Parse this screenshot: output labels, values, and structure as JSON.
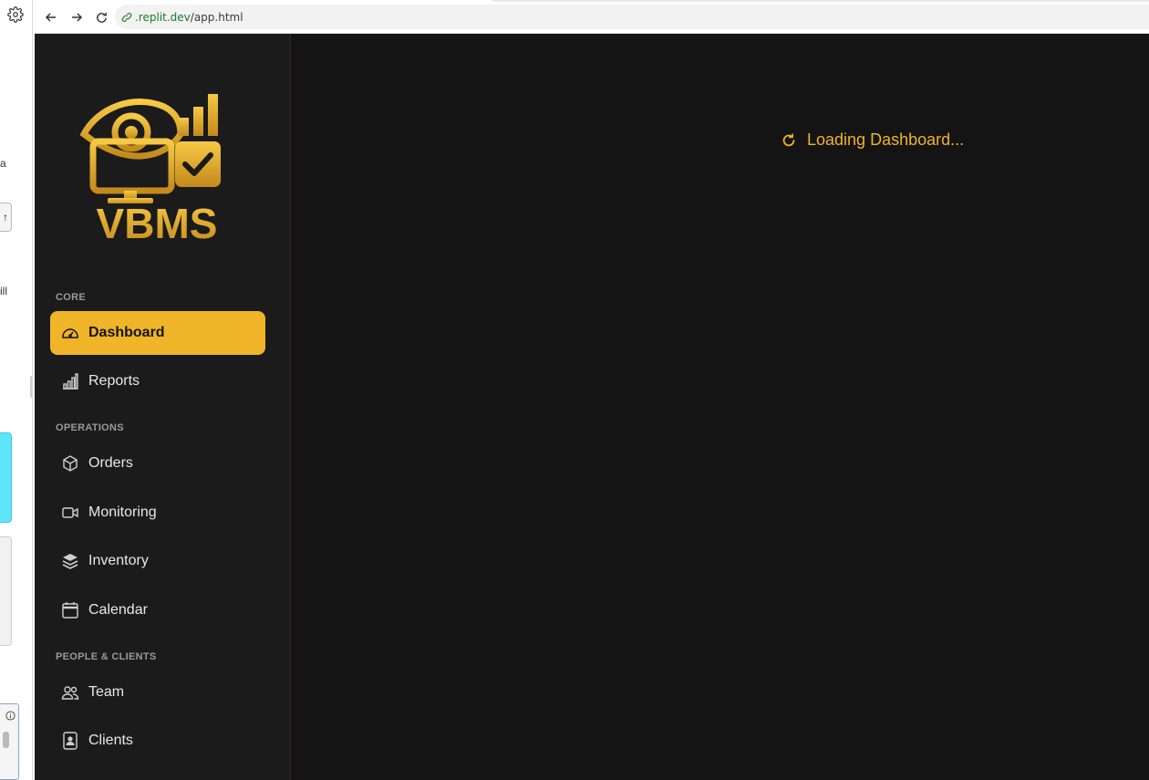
{
  "browser": {
    "url_host": ".replit.dev",
    "url_path": "/app.html"
  },
  "outer_fragments": {
    "frag1": "a",
    "frag2": "ill",
    "frag3": "↑"
  },
  "app": {
    "logo_text": "VBMS",
    "sections": [
      {
        "label": "CORE",
        "items": [
          {
            "label": "Dashboard",
            "icon": "gauge-icon",
            "active": true
          },
          {
            "label": "Reports",
            "icon": "bar-chart-icon",
            "active": false
          }
        ]
      },
      {
        "label": "OPERATIONS",
        "items": [
          {
            "label": "Orders",
            "icon": "box-icon",
            "active": false
          },
          {
            "label": "Monitoring",
            "icon": "video-camera-icon",
            "active": false
          },
          {
            "label": "Inventory",
            "icon": "layers-icon",
            "active": false
          },
          {
            "label": "Calendar",
            "icon": "calendar-icon",
            "active": false
          }
        ]
      },
      {
        "label": "PEOPLE & CLIENTS",
        "items": [
          {
            "label": "Team",
            "icon": "people-icon",
            "active": false
          },
          {
            "label": "Clients",
            "icon": "contact-card-icon",
            "active": false
          }
        ]
      }
    ],
    "loading_text": "Loading Dashboard..."
  },
  "colors": {
    "accent": "#f0b429",
    "sidebar_bg": "#1b1b1b",
    "main_bg": "#141414"
  }
}
